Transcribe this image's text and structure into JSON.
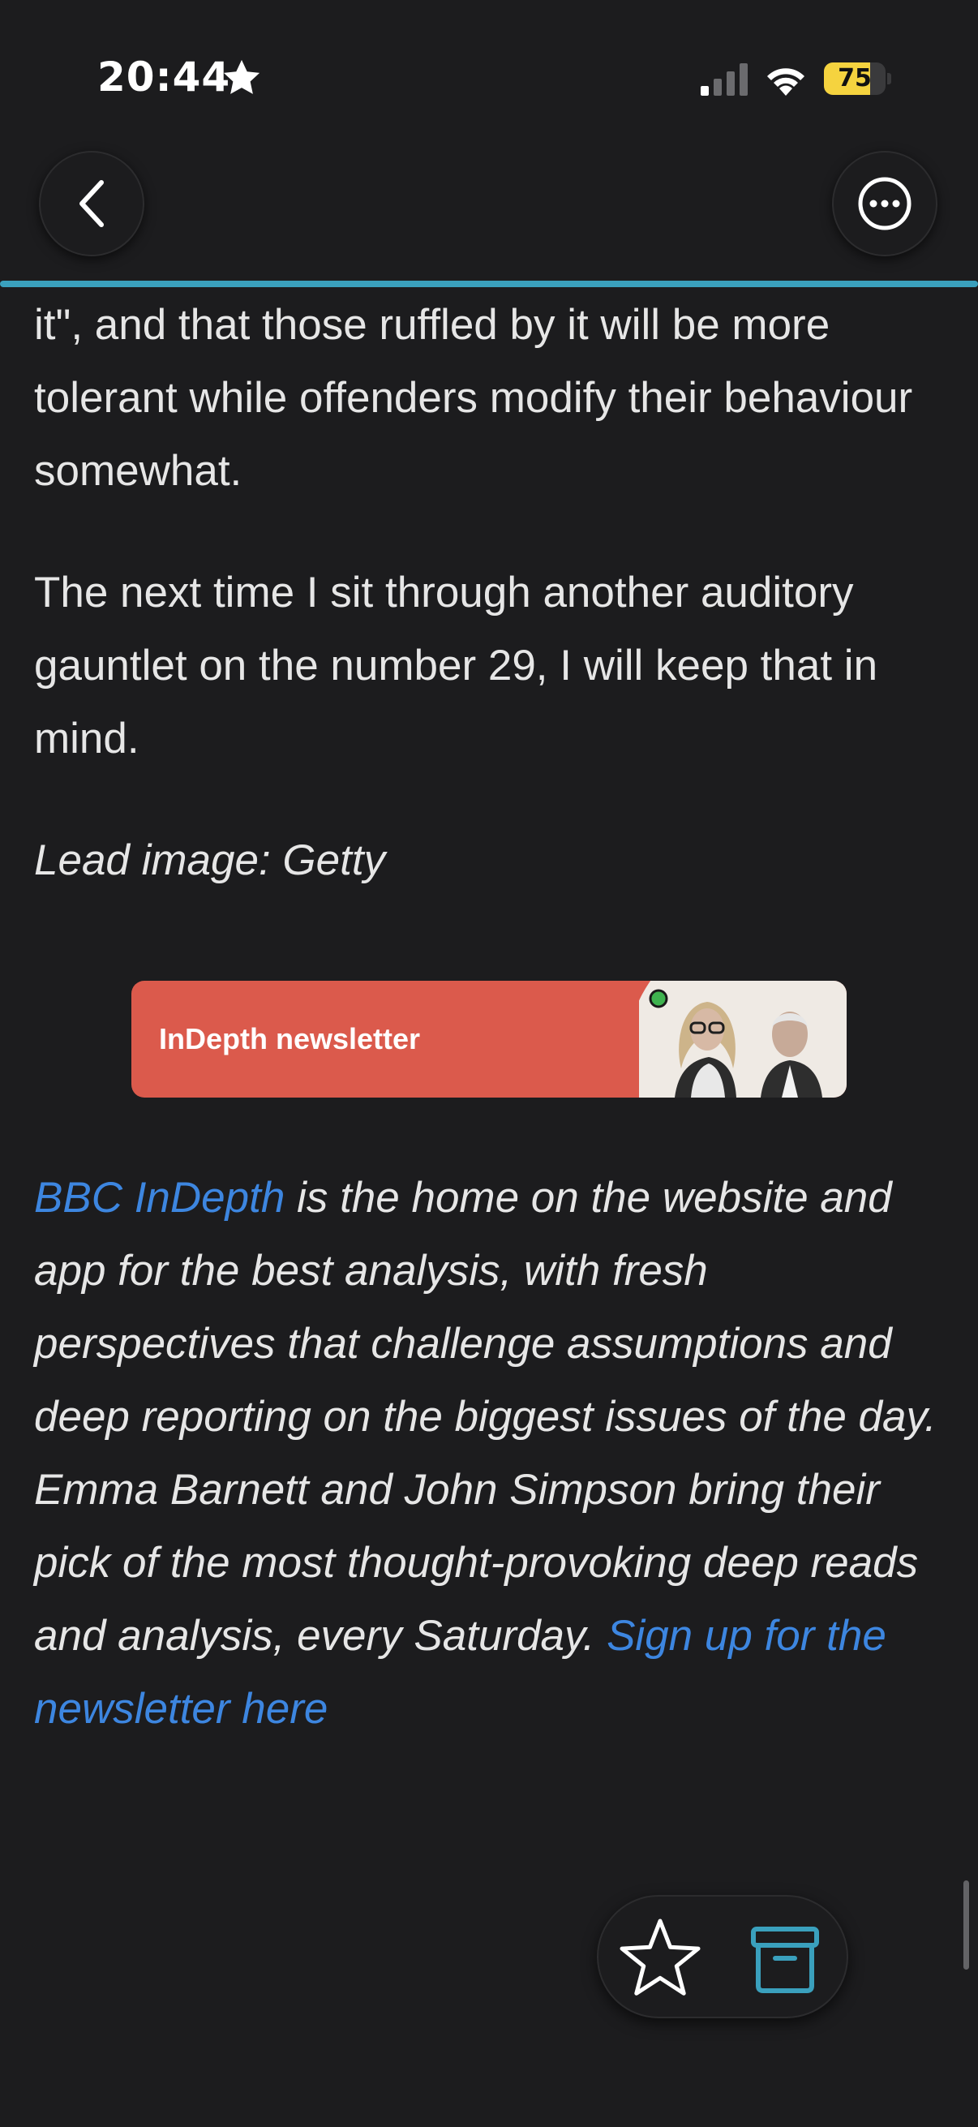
{
  "status_bar": {
    "time": "20:44",
    "battery_level": "75",
    "battery_fraction": 0.75,
    "battery_color": "#f5d33f"
  },
  "nav": {
    "back_icon": "chevron-left-icon",
    "more_icon": "ellipsis-circle-icon"
  },
  "reading_progress_color": "#3aa0bd",
  "article": {
    "paragraphs": [
      "it\", and that those ruffled by it will be more tolerant while offenders modify their behaviour somewhat.",
      "The next time I sit through another auditory gauntlet on the number 29, I will keep that in mind."
    ],
    "caption": "Lead image: Getty",
    "banner": {
      "title": "InDepth newsletter",
      "color": "#db5a4c"
    },
    "promo": {
      "link_1": "BBC InDepth",
      "text": " is the home on the website and app for the best analysis, with fresh perspectives that challenge assumptions and deep reporting on the biggest issues of the day. Emma Barnett and John Simpson bring their pick of the most thought-provoking deep reads and analysis, every Saturday. ",
      "link_2": "Sign up for the newsletter here",
      "link_color": "#3d86e0"
    }
  },
  "actions": {
    "favorite_icon": "star-outline-icon",
    "archive_icon": "archive-box-icon"
  }
}
